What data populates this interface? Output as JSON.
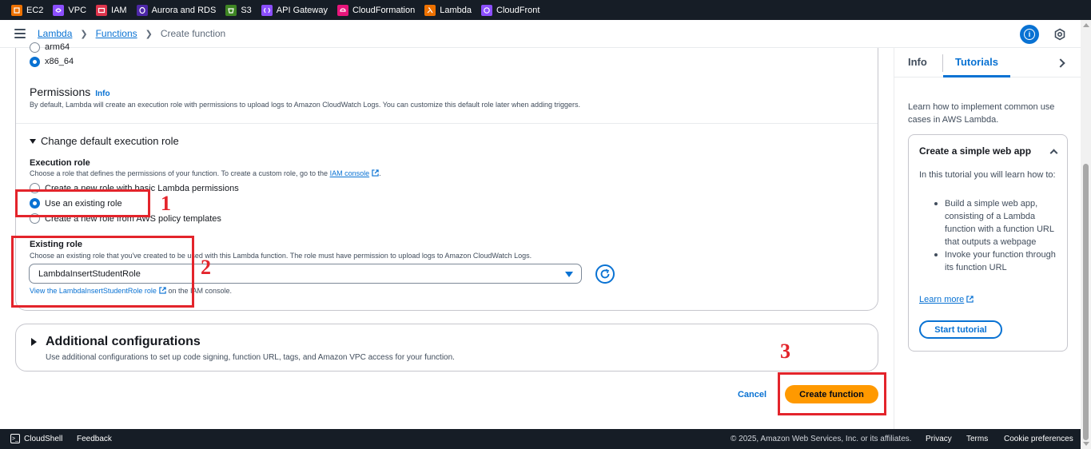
{
  "bookmarks": [
    {
      "label": "EC2",
      "color": "#ed7100",
      "icon": "ec2-icon"
    },
    {
      "label": "VPC",
      "color": "#8c4fff",
      "icon": "vpc-icon"
    },
    {
      "label": "IAM",
      "color": "#dd344c",
      "icon": "iam-icon"
    },
    {
      "label": "Aurora and RDS",
      "color": "#4d27a8",
      "icon": "rds-icon"
    },
    {
      "label": "S3",
      "color": "#3f8624",
      "icon": "s3-icon"
    },
    {
      "label": "API Gateway",
      "color": "#8c4fff",
      "icon": "api-gateway-icon"
    },
    {
      "label": "CloudFormation",
      "color": "#e7157b",
      "icon": "cloudformation-icon"
    },
    {
      "label": "Lambda",
      "color": "#ed7100",
      "icon": "lambda-icon"
    },
    {
      "label": "CloudFront",
      "color": "#8c4fff",
      "icon": "cloudfront-icon"
    }
  ],
  "breadcrumb": {
    "lambda": "Lambda",
    "functions": "Functions",
    "current": "Create function"
  },
  "architecture": {
    "option_arm": "arm64",
    "option_x86": "x86_64"
  },
  "permissions": {
    "title": "Permissions",
    "info": "Info",
    "description": "By default, Lambda will create an execution role with permissions to upload logs to Amazon CloudWatch Logs. You can customize this default role later when adding triggers."
  },
  "execution": {
    "expander": "Change default execution role",
    "label": "Execution role",
    "description": "Choose a role that defines the permissions of your function. To create a custom role, go to the",
    "console_link": "IAM console",
    "period": ".",
    "option_new": "Create a new role with basic Lambda permissions",
    "option_existing": "Use an existing role",
    "option_policy": "Create a new role from AWS policy templates"
  },
  "existing_role": {
    "label": "Existing role",
    "description": "Choose an existing role that you've created to be used with this Lambda function. The role must have permission to upload logs to Amazon CloudWatch Logs.",
    "selected": "LambdaInsertStudentRole",
    "view_link": "View the LambdaInsertStudentRole role",
    "view_suffix": "on the IAM console."
  },
  "additional": {
    "title": "Additional configurations",
    "description": "Use additional configurations to set up code signing, function URL, tags, and Amazon VPC access for your function."
  },
  "actions": {
    "cancel": "Cancel",
    "create": "Create function"
  },
  "annotations": {
    "step1": "1",
    "step2": "2",
    "step3": "3",
    "color": "#e3242b"
  },
  "side_panel": {
    "tab_info": "Info",
    "tab_tutorials": "Tutorials",
    "intro": "Learn how to implement common use cases in AWS Lambda.",
    "card_title": "Create a simple web app",
    "card_body": "In this tutorial you will learn how to:",
    "bullets": [
      "Build a simple web app, consisting of a Lambda function with a function URL that outputs a webpage",
      "Invoke your function through its function URL"
    ],
    "learn_more": "Learn more",
    "start": "Start tutorial"
  },
  "footer": {
    "cloudshell": "CloudShell",
    "feedback": "Feedback",
    "copyright": "© 2025, Amazon Web Services, Inc. or its affiliates.",
    "privacy": "Privacy",
    "terms": "Terms",
    "cookies": "Cookie preferences"
  }
}
